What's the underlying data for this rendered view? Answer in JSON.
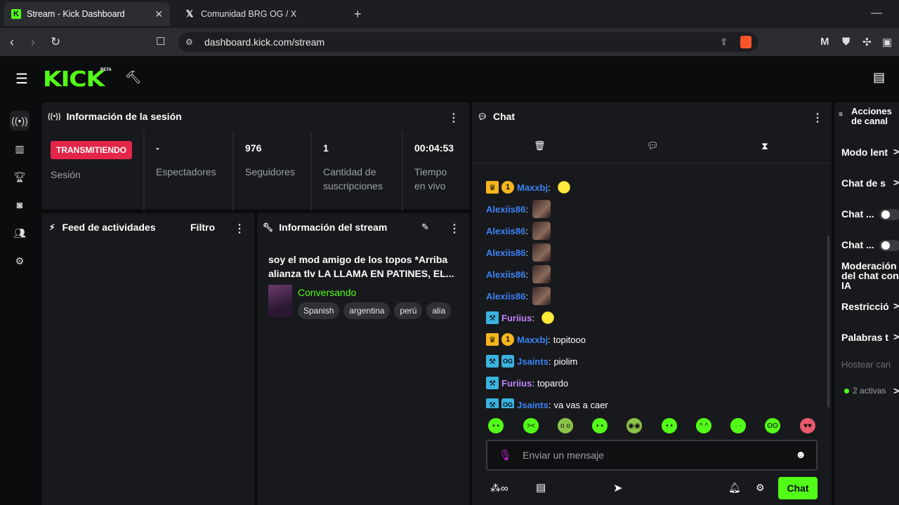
{
  "browser": {
    "tabs": [
      {
        "title": "Stream - Kick Dashboard",
        "favicon": "K"
      },
      {
        "title": "Comunidad BRG OG / X",
        "favicon": "X"
      }
    ],
    "url": "dashboard.kick.com/stream"
  },
  "app": {
    "logo": "KICK",
    "beta": "BETA",
    "accent": "#53fc18"
  },
  "session": {
    "title": "Información de la sesión",
    "status": "TRANSMITIENDO",
    "status_label": "Sesión",
    "stats": [
      {
        "value": "-",
        "label": "Espectadores"
      },
      {
        "value": "976",
        "label": "Seguidores"
      },
      {
        "value": "1",
        "label": "Cantidad de suscripciones"
      },
      {
        "value": "00:04:53",
        "label": "Tiempo en vivo"
      }
    ]
  },
  "feed": {
    "title": "Feed de actividades",
    "filter": "Filtro"
  },
  "stream_info": {
    "title": "Información del stream",
    "stream_title": "soy el mod amigo de los topos *Arriba alianza tlv LA LLAMA EN PATINES, EL...",
    "category": "Conversando",
    "tags": [
      "Spanish",
      "argentina",
      "perú",
      "alia"
    ]
  },
  "chat": {
    "title": "Chat",
    "messages": [
      {
        "user": "Maxxbj",
        "badges": [
          "crown",
          "one"
        ],
        "color": "#3b82f6",
        "text": "",
        "emote": "yellow"
      },
      {
        "user": "Alexiis86",
        "badges": [],
        "color": "#3b82f6",
        "text": "",
        "emote": "face"
      },
      {
        "user": "Alexiis86",
        "badges": [],
        "color": "#3b82f6",
        "text": "",
        "emote": "face"
      },
      {
        "user": "Alexiis86",
        "badges": [],
        "color": "#3b82f6",
        "text": "",
        "emote": "face"
      },
      {
        "user": "Alexiis86",
        "badges": [],
        "color": "#3b82f6",
        "text": "",
        "emote": "face"
      },
      {
        "user": "Alexiis86",
        "badges": [],
        "color": "#3b82f6",
        "text": "",
        "emote": "face"
      },
      {
        "user": "Furiius",
        "badges": [
          "mod"
        ],
        "color": "#c084fc",
        "text": "",
        "emote": "yellow"
      },
      {
        "user": "Maxxbj",
        "badges": [
          "crown",
          "one"
        ],
        "color": "#3b82f6",
        "text": "topitooo",
        "emote": ""
      },
      {
        "user": "Jsaints",
        "badges": [
          "mod",
          "sub"
        ],
        "color": "#3b82f6",
        "text": "piolim",
        "emote": ""
      },
      {
        "user": "Furiius",
        "badges": [
          "mod"
        ],
        "color": "#c084fc",
        "text": "topardo",
        "emote": ""
      },
      {
        "user": "Jsaints",
        "badges": [
          "mod",
          "sub"
        ],
        "color": "#3b82f6",
        "text": "ya vas a caer",
        "emote": ""
      }
    ],
    "placeholder": "Enviar un mensaje",
    "send_label": "Chat"
  },
  "channel_actions": {
    "title": "Acciones de canal",
    "items": [
      {
        "label": "Modo lent",
        "kind": "chevron"
      },
      {
        "label": "Chat de s",
        "kind": "chevron"
      },
      {
        "label": "Chat ...",
        "kind": "toggle"
      },
      {
        "label": "Chat ...",
        "kind": "toggle"
      },
      {
        "label": "Moderación del chat con IA",
        "kind": "none"
      },
      {
        "label": "Restricció",
        "kind": "chevron"
      },
      {
        "label": "Palabras t",
        "kind": "chevron"
      }
    ],
    "host_label": "Hostear can",
    "active_label": "2 activas"
  }
}
